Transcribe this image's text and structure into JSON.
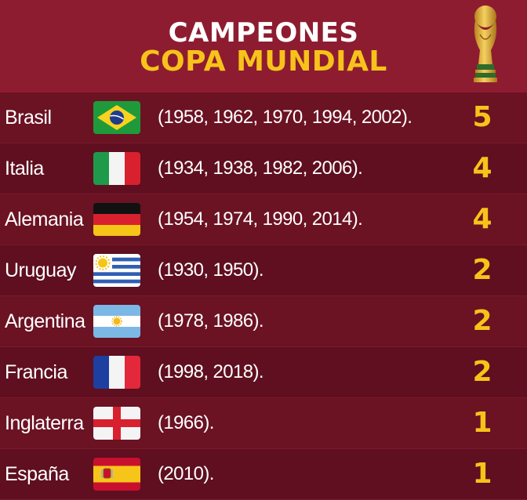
{
  "header": {
    "title_line1": "CAMPEONES",
    "title_line2": "COPA MUNDIAL",
    "trophy_icon": "world-cup-trophy-icon"
  },
  "colors": {
    "header_bg": "#8e1c30",
    "row_bg": "#6b1223",
    "accent_yellow": "#f7c31b",
    "text_white": "#ffffff"
  },
  "champions": [
    {
      "country": "Brasil",
      "flag": "brazil-flag-icon",
      "years": "(1958, 1962, 1970, 1994, 2002).",
      "titles": "5"
    },
    {
      "country": "Italia",
      "flag": "italy-flag-icon",
      "years": "(1934, 1938, 1982, 2006).",
      "titles": "4"
    },
    {
      "country": "Alemania",
      "flag": "germany-flag-icon",
      "years": "(1954, 1974, 1990, 2014).",
      "titles": "4"
    },
    {
      "country": "Uruguay",
      "flag": "uruguay-flag-icon",
      "years": "(1930, 1950).",
      "titles": "2"
    },
    {
      "country": "Argentina",
      "flag": "argentina-flag-icon",
      "years": "(1978, 1986).",
      "titles": "2"
    },
    {
      "country": "Francia",
      "flag": "france-flag-icon",
      "years": "(1998, 2018).",
      "titles": "2"
    },
    {
      "country": "Inglaterra",
      "flag": "england-flag-icon",
      "years": "(1966).",
      "titles": "1"
    },
    {
      "country": "España",
      "flag": "spain-flag-icon",
      "years": "(2010).",
      "titles": "1"
    }
  ]
}
